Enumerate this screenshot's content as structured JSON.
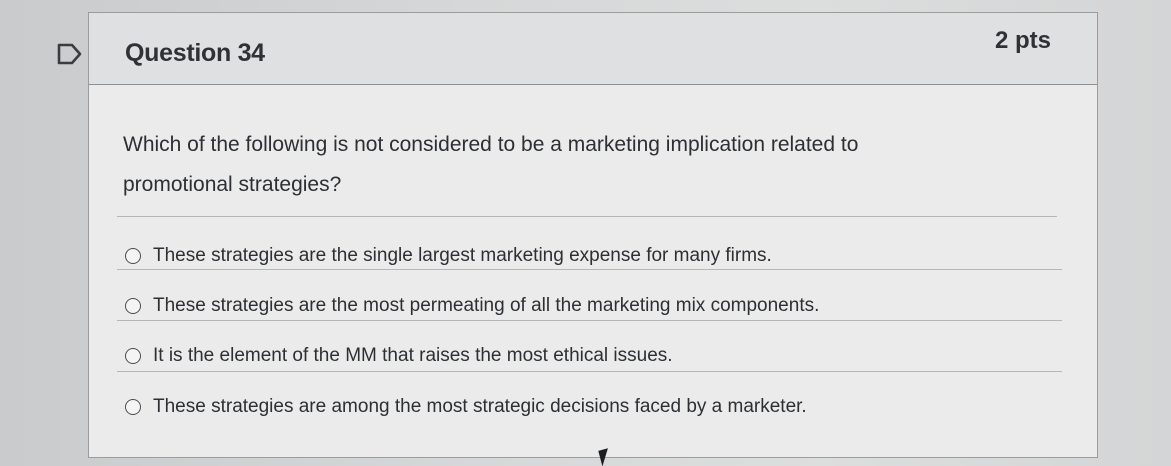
{
  "question": {
    "title": "Question 34",
    "points": "2 pts",
    "text": "Which of the following is not considered to be a marketing implication related to promotional strategies?",
    "answers": [
      {
        "label": "These strategies are the single largest marketing expense for many firms.",
        "selected": false
      },
      {
        "label": "These strategies are the most permeating of all the marketing mix components.",
        "selected": false
      },
      {
        "label": "It is the element of the MM that raises the most ethical issues.",
        "selected": false
      },
      {
        "label": "These strategies are among the most strategic decisions faced by a marketer.",
        "selected": false
      }
    ]
  },
  "icons": {
    "flag": "flag-outline-icon",
    "cursor": "mouse-pointer-icon"
  },
  "colors": {
    "text": "#2c2f33",
    "header_bg": "#dfe0e1",
    "card_bg": "#ebebeb",
    "border": "#9a9c9e"
  }
}
